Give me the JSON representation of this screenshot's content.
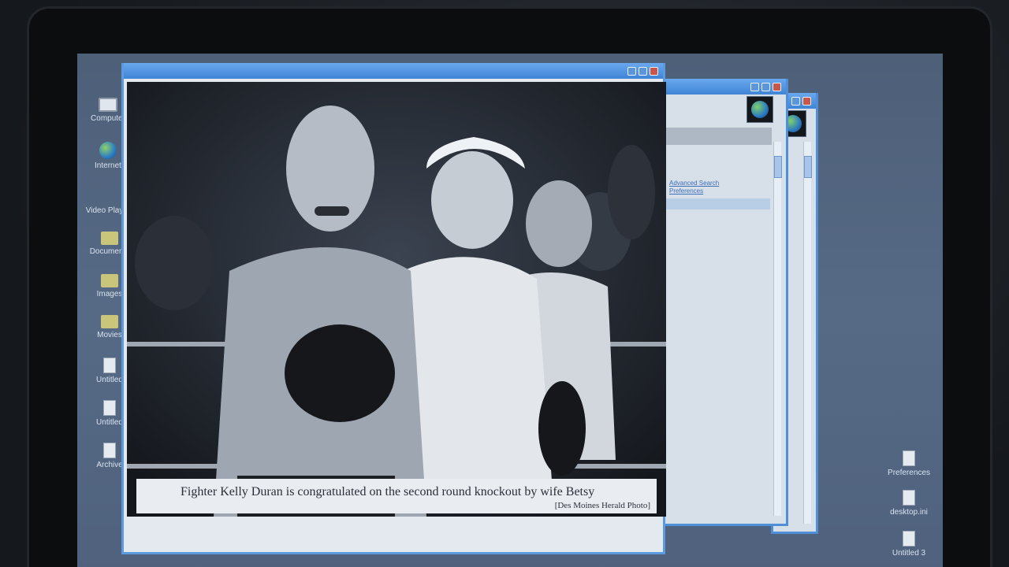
{
  "desktop": {
    "left_icons": [
      {
        "label": "Computer",
        "icon": "computer-icon"
      },
      {
        "label": "Internet",
        "icon": "globe-icon"
      },
      {
        "label": "Video Player",
        "icon": "video-icon"
      },
      {
        "label": "Documents",
        "icon": "folder-icon"
      },
      {
        "label": "Images",
        "icon": "folder-icon"
      },
      {
        "label": "Movies",
        "icon": "folder-icon"
      },
      {
        "label": "Untitled",
        "icon": "document-icon"
      },
      {
        "label": "Untitled",
        "icon": "document-icon"
      },
      {
        "label": "Archive",
        "icon": "document-icon"
      }
    ],
    "right_icons": [
      {
        "label": "Preferences",
        "icon": "document-icon"
      },
      {
        "label": "desktop.ini",
        "icon": "document-icon"
      },
      {
        "label": "Untitled 3",
        "icon": "document-icon"
      }
    ]
  },
  "browser_window": {
    "links": [
      "Advanced Search",
      "Preferences"
    ]
  },
  "photo_window": {
    "caption": "Fighter Kelly Duran is congratulated on the second round knockout by wife Betsy",
    "credit": "[Des Moines Herald Photo]"
  },
  "colors": {
    "titlebar": "#3f84d6",
    "desktop": "#566a86",
    "close_button": "#c7574a"
  }
}
